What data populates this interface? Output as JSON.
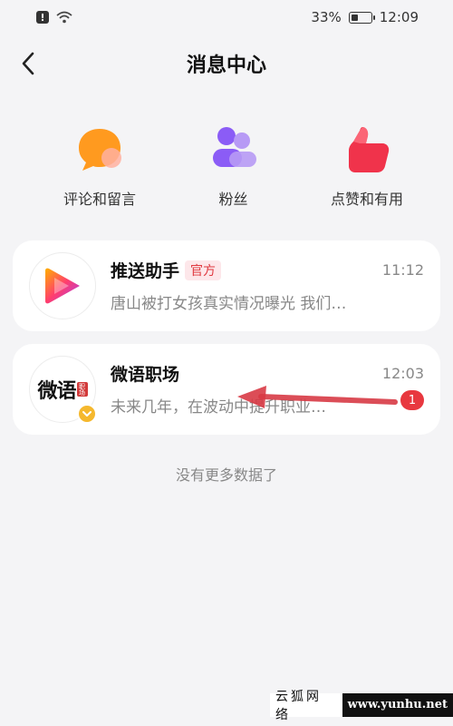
{
  "status_bar": {
    "battery": "33%",
    "time": "12:09"
  },
  "header": {
    "title": "消息中心"
  },
  "categories": [
    {
      "label": "评论和留言",
      "icon": "comment-bubble-icon",
      "color": "#ff9a1f"
    },
    {
      "label": "粉丝",
      "icon": "fans-people-icon",
      "color": "#8b5cf6"
    },
    {
      "label": "点赞和有用",
      "icon": "thumbs-up-icon",
      "color": "#f0334b"
    }
  ],
  "messages": [
    {
      "name": "推送助手",
      "badge": "官方",
      "time": "11:12",
      "preview": "唐山被打女孩真实情况曝光 我们…",
      "avatar": "play-logo-icon",
      "unread": ""
    },
    {
      "name": "微语职场",
      "time": "12:03",
      "preview": "未来几年，在波动中提升职业…",
      "avatar_text": "微语",
      "avatar_sub": "职场",
      "unread": "1"
    }
  ],
  "footer": {
    "note": "没有更多数据了"
  },
  "watermark": {
    "left": "云狐网络",
    "right": "www.yunhu.net"
  },
  "colors": {
    "accent_red": "#e8383f",
    "arrow": "#d83a45"
  }
}
